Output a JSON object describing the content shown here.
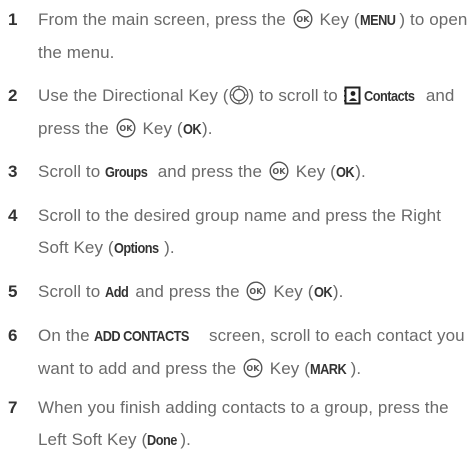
{
  "steps": [
    {
      "number": "1",
      "t1": "From the main screen, press the",
      "t2": "Key (",
      "k1": "MENU",
      "t3": ") to open the menu."
    },
    {
      "number": "2",
      "t1": "Use the Directional Key (",
      "t2": ") to scroll to",
      "k1": "Contacts",
      "t3": "and press the",
      "t4": "Key (",
      "k2": "OK",
      "t5": ")."
    },
    {
      "number": "3",
      "t1": "Scroll to",
      "k1": "Groups",
      "t2": "and press the",
      "t3": "Key (",
      "k2": "OK",
      "t4": ")."
    },
    {
      "number": "4",
      "t1": "Scroll to the desired group name and press the Right Soft Key (",
      "k1": "Options",
      "t2": ")."
    },
    {
      "number": "5",
      "t1": "Scroll to",
      "k1": "Add",
      "t2": "and press the",
      "t3": "Key (",
      "k2": "OK",
      "t4": ")."
    },
    {
      "number": "6",
      "t1": "On the",
      "k1": "ADD CONTACTS",
      "t2": "screen, scroll to each contact you want to add and press the",
      "t3": "Key (",
      "k2": "MARK",
      "t4": ")."
    },
    {
      "number": "7",
      "t1": "When you finish adding contacts to a group, press the Left Soft Key (",
      "k1": "Done",
      "t2": ")."
    }
  ],
  "icons": {
    "ok_key": "ok-key-icon",
    "directional_key": "directional-key-icon",
    "contacts": "contacts-icon"
  },
  "colors": {
    "body_text": "#6a6a6a",
    "keyword_text": "#333333",
    "step_number": "#333333"
  }
}
